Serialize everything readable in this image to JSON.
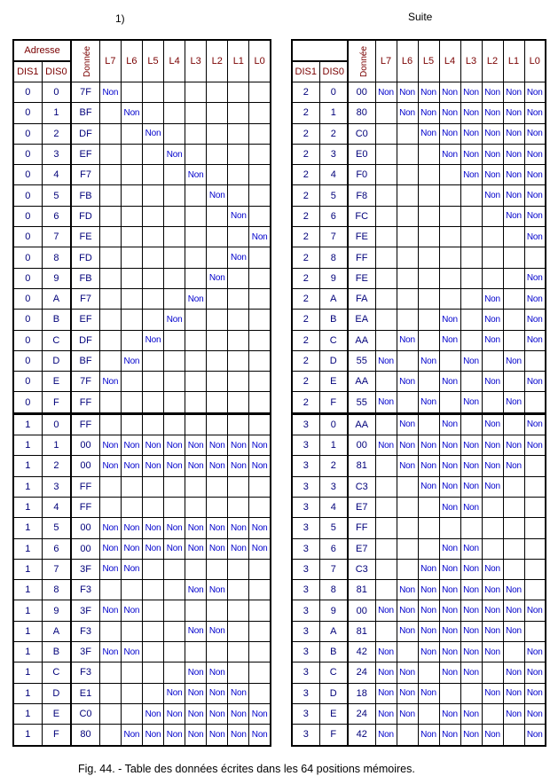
{
  "labels": {
    "left": "1)",
    "right": "Suite"
  },
  "headers": {
    "adresse": "Adresse",
    "right_addr": "",
    "dis1": "DIS1",
    "dis0": "DIS0",
    "donnee": "Donnée",
    "leds": [
      "L7",
      "L6",
      "L5",
      "L4",
      "L3",
      "L2",
      "L1",
      "L0"
    ]
  },
  "non_text": "Non",
  "caption": "Fig. 44. - Table des données écrites dans les 64 positions mémoires.",
  "tables": {
    "left": [
      {
        "dis1": "0",
        "dis0": "0",
        "data": "7F"
      },
      {
        "dis1": "0",
        "dis0": "1",
        "data": "BF"
      },
      {
        "dis1": "0",
        "dis0": "2",
        "data": "DF"
      },
      {
        "dis1": "0",
        "dis0": "3",
        "data": "EF"
      },
      {
        "dis1": "0",
        "dis0": "4",
        "data": "F7"
      },
      {
        "dis1": "0",
        "dis0": "5",
        "data": "FB"
      },
      {
        "dis1": "0",
        "dis0": "6",
        "data": "FD"
      },
      {
        "dis1": "0",
        "dis0": "7",
        "data": "FE"
      },
      {
        "dis1": "0",
        "dis0": "8",
        "data": "FD"
      },
      {
        "dis1": "0",
        "dis0": "9",
        "data": "FB"
      },
      {
        "dis1": "0",
        "dis0": "A",
        "data": "F7"
      },
      {
        "dis1": "0",
        "dis0": "B",
        "data": "EF"
      },
      {
        "dis1": "0",
        "dis0": "C",
        "data": "DF"
      },
      {
        "dis1": "0",
        "dis0": "D",
        "data": "BF"
      },
      {
        "dis1": "0",
        "dis0": "E",
        "data": "7F"
      },
      {
        "dis1": "0",
        "dis0": "F",
        "data": "FF"
      },
      {
        "dis1": "1",
        "dis0": "0",
        "data": "FF"
      },
      {
        "dis1": "1",
        "dis0": "1",
        "data": "00"
      },
      {
        "dis1": "1",
        "dis0": "2",
        "data": "00"
      },
      {
        "dis1": "1",
        "dis0": "3",
        "data": "FF"
      },
      {
        "dis1": "1",
        "dis0": "4",
        "data": "FF"
      },
      {
        "dis1": "1",
        "dis0": "5",
        "data": "00"
      },
      {
        "dis1": "1",
        "dis0": "6",
        "data": "00"
      },
      {
        "dis1": "1",
        "dis0": "7",
        "data": "3F"
      },
      {
        "dis1": "1",
        "dis0": "8",
        "data": "F3"
      },
      {
        "dis1": "1",
        "dis0": "9",
        "data": "3F"
      },
      {
        "dis1": "1",
        "dis0": "A",
        "data": "F3"
      },
      {
        "dis1": "1",
        "dis0": "B",
        "data": "3F"
      },
      {
        "dis1": "1",
        "dis0": "C",
        "data": "F3"
      },
      {
        "dis1": "1",
        "dis0": "D",
        "data": "E1"
      },
      {
        "dis1": "1",
        "dis0": "E",
        "data": "C0"
      },
      {
        "dis1": "1",
        "dis0": "F",
        "data": "80"
      }
    ],
    "right": [
      {
        "dis1": "2",
        "dis0": "0",
        "data": "00"
      },
      {
        "dis1": "2",
        "dis0": "1",
        "data": "80"
      },
      {
        "dis1": "2",
        "dis0": "2",
        "data": "C0"
      },
      {
        "dis1": "2",
        "dis0": "3",
        "data": "E0"
      },
      {
        "dis1": "2",
        "dis0": "4",
        "data": "F0"
      },
      {
        "dis1": "2",
        "dis0": "5",
        "data": "F8"
      },
      {
        "dis1": "2",
        "dis0": "6",
        "data": "FC"
      },
      {
        "dis1": "2",
        "dis0": "7",
        "data": "FE"
      },
      {
        "dis1": "2",
        "dis0": "8",
        "data": "FF"
      },
      {
        "dis1": "2",
        "dis0": "9",
        "data": "FE"
      },
      {
        "dis1": "2",
        "dis0": "A",
        "data": "FA"
      },
      {
        "dis1": "2",
        "dis0": "B",
        "data": "EA"
      },
      {
        "dis1": "2",
        "dis0": "C",
        "data": "AA"
      },
      {
        "dis1": "2",
        "dis0": "D",
        "data": "55"
      },
      {
        "dis1": "2",
        "dis0": "E",
        "data": "AA"
      },
      {
        "dis1": "2",
        "dis0": "F",
        "data": "55"
      },
      {
        "dis1": "3",
        "dis0": "0",
        "data": "AA"
      },
      {
        "dis1": "3",
        "dis0": "1",
        "data": "00"
      },
      {
        "dis1": "3",
        "dis0": "2",
        "data": "81"
      },
      {
        "dis1": "3",
        "dis0": "3",
        "data": "C3"
      },
      {
        "dis1": "3",
        "dis0": "4",
        "data": "E7"
      },
      {
        "dis1": "3",
        "dis0": "5",
        "data": "FF"
      },
      {
        "dis1": "3",
        "dis0": "6",
        "data": "E7"
      },
      {
        "dis1": "3",
        "dis0": "7",
        "data": "C3"
      },
      {
        "dis1": "3",
        "dis0": "8",
        "data": "81"
      },
      {
        "dis1": "3",
        "dis0": "9",
        "data": "00"
      },
      {
        "dis1": "3",
        "dis0": "A",
        "data": "81"
      },
      {
        "dis1": "3",
        "dis0": "B",
        "data": "42"
      },
      {
        "dis1": "3",
        "dis0": "C",
        "data": "24"
      },
      {
        "dis1": "3",
        "dis0": "D",
        "data": "18"
      },
      {
        "dis1": "3",
        "dis0": "E",
        "data": "24"
      },
      {
        "dis1": "3",
        "dis0": "F",
        "data": "42"
      }
    ]
  }
}
